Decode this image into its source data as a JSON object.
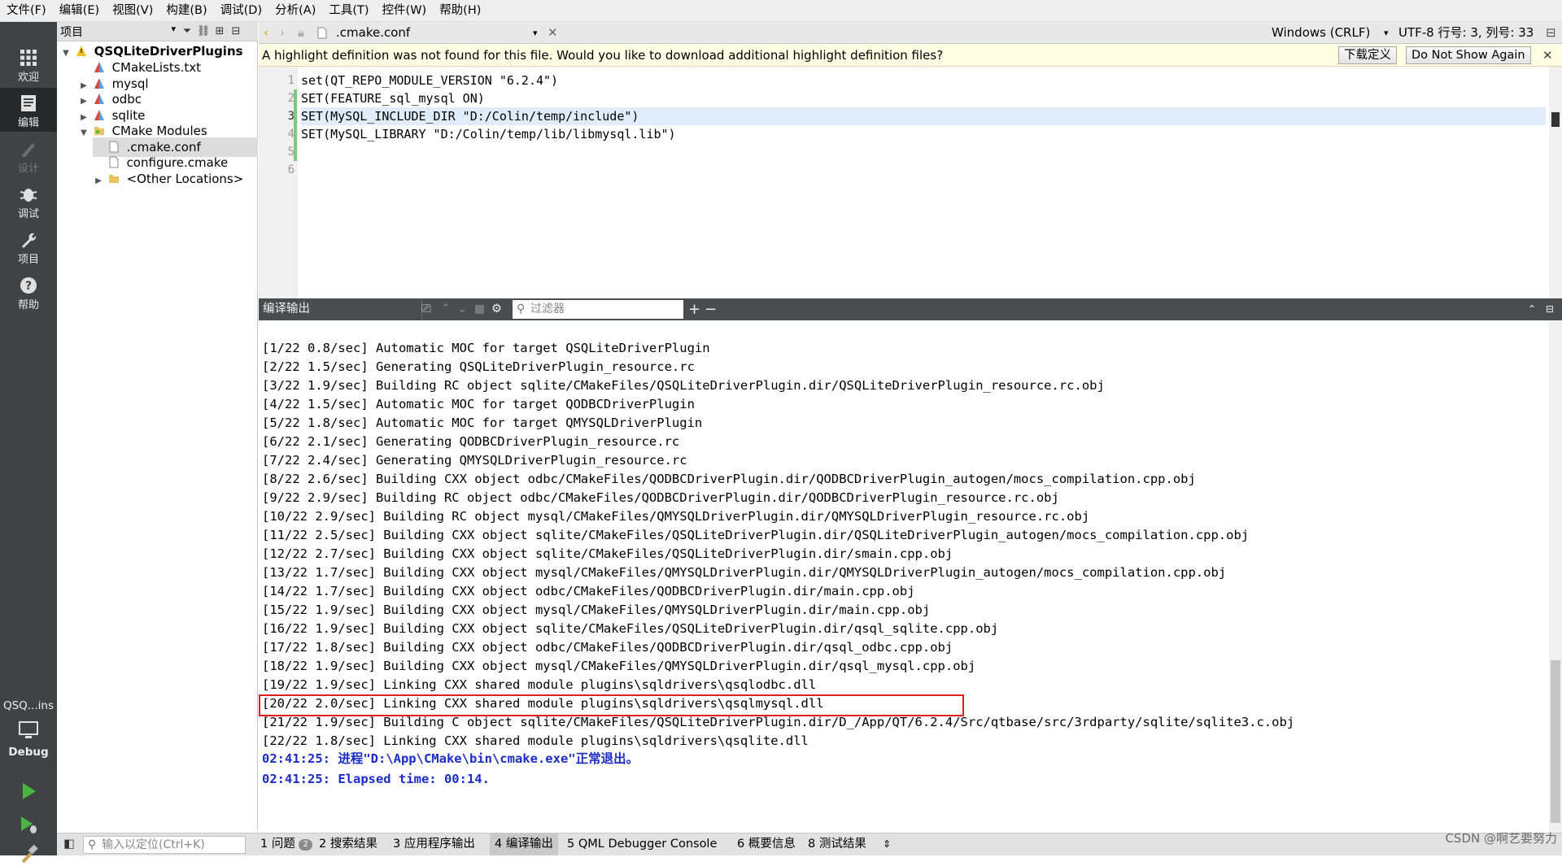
{
  "menubar": [
    "文件(F)",
    "编辑(E)",
    "视图(V)",
    "构建(B)",
    "调试(D)",
    "分析(A)",
    "工具(T)",
    "控件(W)",
    "帮助(H)"
  ],
  "modes": {
    "welcome": "欢迎",
    "edit": "编辑",
    "design": "设计",
    "debug": "调试",
    "projects": "项目",
    "help": "帮助"
  },
  "kit": {
    "project": "QSQ...ins",
    "config": "Debug"
  },
  "project_pane": {
    "combo": "项目",
    "tree": [
      {
        "label": "QSQLiteDriverPlugins",
        "bold": true
      },
      {
        "label": "CMakeLists.txt"
      },
      {
        "label": "mysql"
      },
      {
        "label": "odbc"
      },
      {
        "label": "sqlite"
      },
      {
        "label": "CMake Modules"
      },
      {
        "label": ".cmake.conf"
      },
      {
        "label": "configure.cmake"
      },
      {
        "label": "<Other Locations>"
      }
    ]
  },
  "editor_toolbar": {
    "file": ".cmake.conf",
    "line_ending": "Windows (CRLF)",
    "encoding_position": "UTF-8 行号: 3, 列号: 33"
  },
  "infobar": {
    "message": "A highlight definition was not found for this file. Would you like to download additional highlight definition files?",
    "download_button": "下载定义",
    "dont_show_button": "Do Not Show Again"
  },
  "editor": {
    "line_numbers": [
      "1",
      "2",
      "3",
      "4",
      "5",
      "6"
    ],
    "lines": [
      "set(QT_REPO_MODULE_VERSION \"6.2.4\")",
      "SET(FEATURE_sql_mysql ON)",
      "SET(MySQL_INCLUDE_DIR \"D:/Colin/temp/include\")",
      "SET(MySQL_LIBRARY \"D:/Colin/temp/lib/libmysql.lib\")",
      "",
      ""
    ]
  },
  "output_pane": {
    "title": "编译输出",
    "filter_placeholder": "过滤器",
    "lines": [
      "[1/22 0.8/sec] Automatic MOC for target QSQLiteDriverPlugin",
      "[2/22 1.5/sec] Generating QSQLiteDriverPlugin_resource.rc",
      "[3/22 1.9/sec] Building RC object sqlite/CMakeFiles/QSQLiteDriverPlugin.dir/QSQLiteDriverPlugin_resource.rc.obj",
      "[4/22 1.5/sec] Automatic MOC for target QODBCDriverPlugin",
      "[5/22 1.8/sec] Automatic MOC for target QMYSQLDriverPlugin",
      "[6/22 2.1/sec] Generating QODBCDriverPlugin_resource.rc",
      "[7/22 2.4/sec] Generating QMYSQLDriverPlugin_resource.rc",
      "[8/22 2.6/sec] Building CXX object odbc/CMakeFiles/QODBCDriverPlugin.dir/QODBCDriverPlugin_autogen/mocs_compilation.cpp.obj",
      "[9/22 2.9/sec] Building RC object odbc/CMakeFiles/QODBCDriverPlugin.dir/QODBCDriverPlugin_resource.rc.obj",
      "[10/22 2.9/sec] Building RC object mysql/CMakeFiles/QMYSQLDriverPlugin.dir/QMYSQLDriverPlugin_resource.rc.obj",
      "[11/22 2.5/sec] Building CXX object sqlite/CMakeFiles/QSQLiteDriverPlugin.dir/QSQLiteDriverPlugin_autogen/mocs_compilation.cpp.obj",
      "[12/22 2.7/sec] Building CXX object sqlite/CMakeFiles/QSQLiteDriverPlugin.dir/smain.cpp.obj",
      "[13/22 1.7/sec] Building CXX object mysql/CMakeFiles/QMYSQLDriverPlugin.dir/QMYSQLDriverPlugin_autogen/mocs_compilation.cpp.obj",
      "[14/22 1.7/sec] Building CXX object odbc/CMakeFiles/QODBCDriverPlugin.dir/main.cpp.obj",
      "[15/22 1.9/sec] Building CXX object mysql/CMakeFiles/QMYSQLDriverPlugin.dir/main.cpp.obj",
      "[16/22 1.9/sec] Building CXX object sqlite/CMakeFiles/QSQLiteDriverPlugin.dir/qsql_sqlite.cpp.obj",
      "[17/22 1.8/sec] Building CXX object odbc/CMakeFiles/QODBCDriverPlugin.dir/qsql_odbc.cpp.obj",
      "[18/22 1.9/sec] Building CXX object mysql/CMakeFiles/QMYSQLDriverPlugin.dir/qsql_mysql.cpp.obj",
      "[19/22 1.9/sec] Linking CXX shared module plugins\\sqldrivers\\qsqlodbc.dll",
      "[20/22 2.0/sec] Linking CXX shared module plugins\\sqldrivers\\qsqlmysql.dll",
      "[21/22 1.9/sec] Building C object sqlite/CMakeFiles/QSQLiteDriverPlugin.dir/D_/App/QT/6.2.4/Src/qtbase/src/3rdparty/sqlite/sqlite3.c.obj",
      "[22/22 1.8/sec] Linking CXX shared module plugins\\sqldrivers\\qsqlite.dll"
    ],
    "status_lines": [
      "02:41:25: 进程\"D:\\App\\CMake\\bin\\cmake.exe\"正常退出。",
      "02:41:25: Elapsed time: 00:14."
    ]
  },
  "statusbar": {
    "locator_placeholder": "输入以定位(Ctrl+K)",
    "tabs": [
      {
        "label": "1 问题",
        "badge": "2"
      },
      {
        "label": "2 搜索结果"
      },
      {
        "label": "3 应用程序输出"
      },
      {
        "label": "4 编译输出",
        "active": true
      },
      {
        "label": "5 QML Debugger Console"
      },
      {
        "label": "6 概要信息"
      },
      {
        "label": "8 测试结果"
      }
    ]
  },
  "watermark": "CSDN @啊艺要努力"
}
